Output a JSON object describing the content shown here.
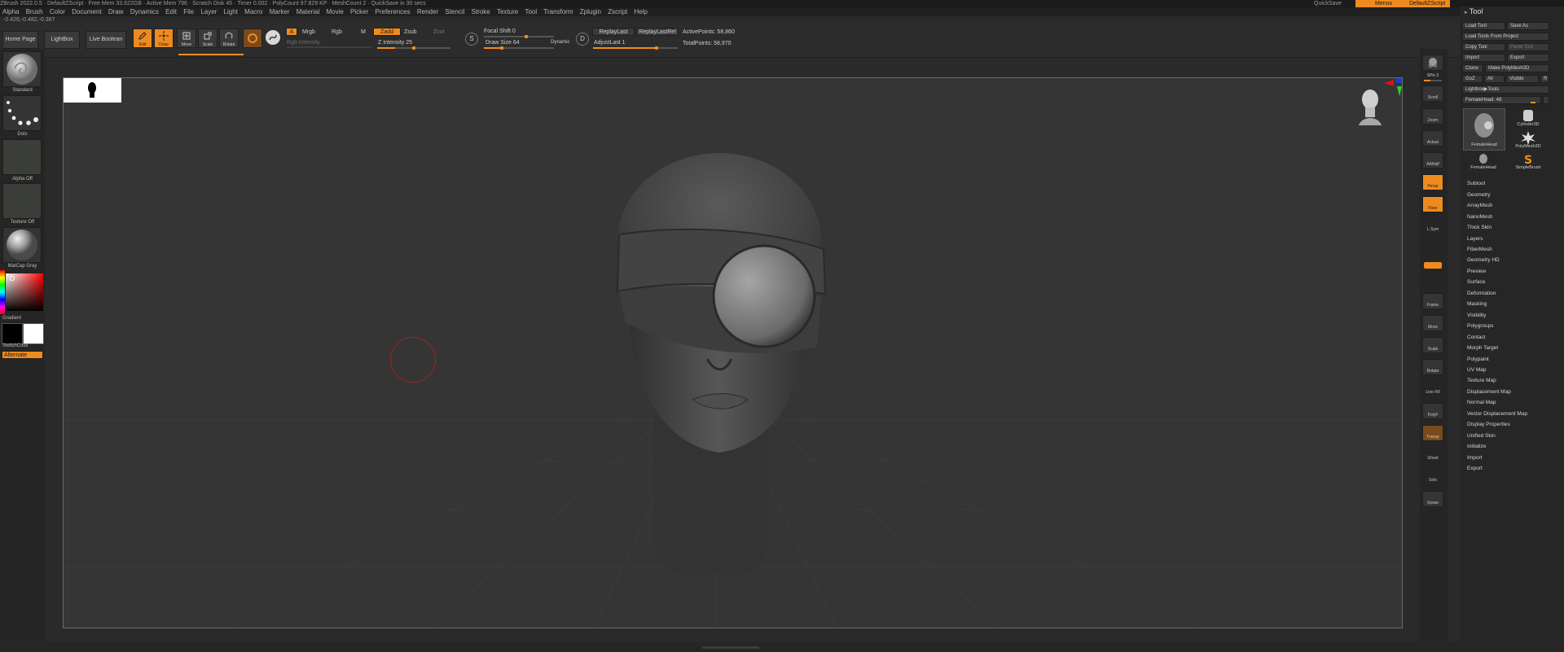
{
  "titlebar": {
    "text": "ZBrush 2022.0.5 · DefaultZScript · Free Mem 33.622GB · Active Mem 796 · Scratch Disk 45 · Timer 0.002 · PolyCount 97.829 KP · MeshCount 2 · QuickSave in 30 secs",
    "quicksave": "QuickSave",
    "menus_label": "Menus",
    "script_label": "DefaultZScript"
  },
  "menu": [
    "Alpha",
    "Brush",
    "Color",
    "Document",
    "Draw",
    "Dynamics",
    "Edit",
    "File",
    "Layer",
    "Light",
    "Macro",
    "Marker",
    "Material",
    "Movie",
    "Picker",
    "Preferences",
    "Render",
    "Stencil",
    "Stroke",
    "Texture",
    "Tool",
    "Transform",
    "Zplugin",
    "Zscript",
    "Help"
  ],
  "coords": "-2.426,-0.482,-0.367",
  "topshelf": {
    "home": "Home Page",
    "lightbox": "LightBox",
    "livebool": "Live Boolean",
    "edit": "Edit",
    "draw": "Draw",
    "move": "Move",
    "scale": "Scale",
    "rotate": "Rotate",
    "a": "A",
    "mrgb": "Mrgb",
    "rgb": "Rgb",
    "m": "M",
    "zadd": "Zadd",
    "zsub": "Zsub",
    "zcut": "Zcut",
    "rgb_intensity": "Rgb Intensity",
    "z_intensity_label": "Z Intensity",
    "z_intensity": 25,
    "focal_label": "Focal Shift",
    "focal": 0,
    "draw_size_label": "Draw Size",
    "draw_size": 64,
    "dynamic": "Dynamic",
    "replay_last": "ReplayLast",
    "replay_last_rel": "ReplayLastRel",
    "adjust_label": "AdjustLast",
    "adjust": 1,
    "active_label": "ActivePoints:",
    "active": "58,860",
    "total_label": "TotalPoints:",
    "total": "58,970"
  },
  "leftshelf": {
    "standard": "Standard",
    "dots": "Dots",
    "alpha": "Alpha Off",
    "texture": "Texture Off",
    "matcap": "MatCap Gray",
    "gradient": "Gradient",
    "switch": "SwitchColor",
    "alternate": "Alternate"
  },
  "rightshelf": [
    "BPR",
    "SPix 3",
    "Scroll",
    "Zoom",
    "Actual",
    "AAHalf",
    "Persp",
    "Floor",
    "L.Sym",
    "Frame",
    "Move",
    "Scale",
    "Rotate",
    "Line Fill",
    "PolyF",
    "Transp",
    "Ghost",
    "Solo",
    "Xpose"
  ],
  "toolpanel": {
    "title": "Tool",
    "load": "Load Tool",
    "saveas": "Save As",
    "loadproject": "Load Tools From Project",
    "copy": "Copy Tool",
    "paste": "Paste Tool",
    "import": "Import",
    "export": "Export",
    "clone": "Clone",
    "make": "Make PolyMesh3D",
    "goz": "GoZ",
    "all": "All",
    "visible": "Visible",
    "r": "R",
    "lightbox_tools": "Lightbox▶Tools",
    "current_label": "FemaleHead. 48",
    "thumbs": [
      "FemaleHead",
      "Cylinder3D",
      "PolyMesh3D",
      "FemaleHead",
      "SimpleBrush"
    ],
    "sections": [
      "Subtool",
      "Geometry",
      "ArrayMesh",
      "NanoMesh",
      "Thick Skin",
      "Layers",
      "FiberMesh",
      "Geometry HD",
      "Preview",
      "Surface",
      "Deformation",
      "Masking",
      "Visibility",
      "Polygroups",
      "Contact",
      "Morph Target",
      "Polypaint",
      "UV Map",
      "Texture Map",
      "Displacement Map",
      "Normal Map",
      "Vector Displacement Map",
      "Display Properties",
      "Unified Skin",
      "Initialize",
      "Import",
      "Export"
    ]
  },
  "colors": {
    "accent": "#ef8b1e",
    "canvas_bg": "#353535",
    "panel_bg": "#262626"
  }
}
